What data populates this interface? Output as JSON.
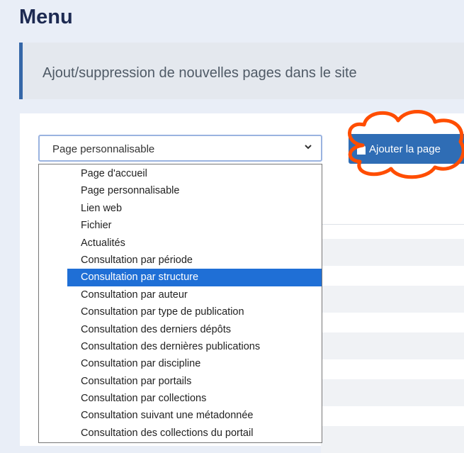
{
  "page": {
    "title": "Menu",
    "info": "Ajout/suppression de nouvelles pages dans le site"
  },
  "form": {
    "selected_value": "Page personnalisable",
    "add_button_label": "Ajouter la page",
    "options": [
      {
        "label": "Page d'accueil",
        "selected": false
      },
      {
        "label": "Page personnalisable",
        "selected": false
      },
      {
        "label": "Lien web",
        "selected": false
      },
      {
        "label": "Fichier",
        "selected": false
      },
      {
        "label": "Actualités",
        "selected": false
      },
      {
        "label": "Consultation par période",
        "selected": false
      },
      {
        "label": "Consultation par structure",
        "selected": true
      },
      {
        "label": "Consultation par auteur",
        "selected": false
      },
      {
        "label": "Consultation par type de publication",
        "selected": false
      },
      {
        "label": "Consultation des derniers dépôts",
        "selected": false
      },
      {
        "label": "Consultation des dernières publications",
        "selected": false
      },
      {
        "label": "Consultation par discipline",
        "selected": false
      },
      {
        "label": "Consultation par portails",
        "selected": false
      },
      {
        "label": "Consultation par collections",
        "selected": false
      },
      {
        "label": "Consultation suivant une métadonnée",
        "selected": false
      },
      {
        "label": "Consultation des collections du portail",
        "selected": false
      }
    ]
  },
  "colors": {
    "accent": "#2f6db5",
    "highlight": "#1f6fd6",
    "annotation": "#ff4d00"
  },
  "icons": {
    "select_arrow": "chevron-down-icon",
    "button_icon": "file-icon"
  }
}
